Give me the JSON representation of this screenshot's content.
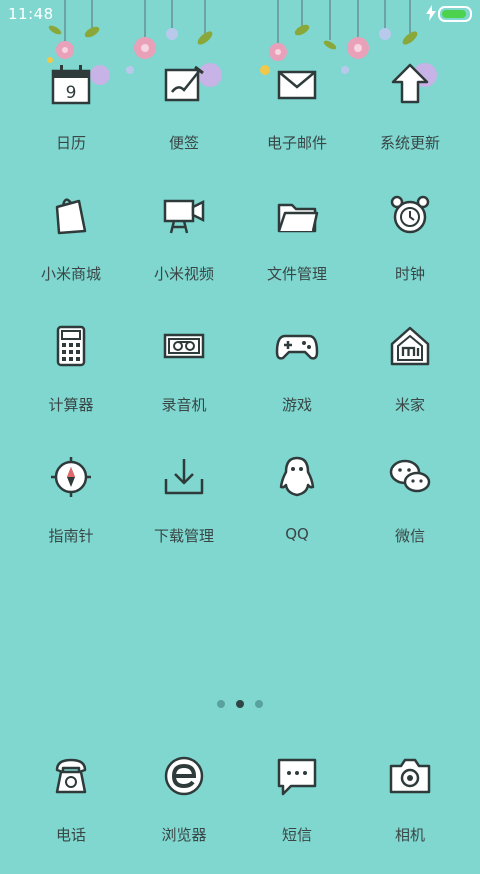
{
  "status_bar": {
    "time": "11:48"
  },
  "apps": [
    {
      "label": "日历",
      "icon": "calendar-icon",
      "calendar_day": "9"
    },
    {
      "label": "便签",
      "icon": "notes-icon"
    },
    {
      "label": "电子邮件",
      "icon": "email-icon"
    },
    {
      "label": "系统更新",
      "icon": "system-update-icon"
    },
    {
      "label": "小米商城",
      "icon": "shopping-bag-icon"
    },
    {
      "label": "小米视频",
      "icon": "video-camera-icon"
    },
    {
      "label": "文件管理",
      "icon": "folder-icon"
    },
    {
      "label": "时钟",
      "icon": "alarm-clock-icon"
    },
    {
      "label": "计算器",
      "icon": "calculator-icon"
    },
    {
      "label": "录音机",
      "icon": "recorder-icon"
    },
    {
      "label": "游戏",
      "icon": "gamepad-icon"
    },
    {
      "label": "米家",
      "icon": "mi-home-icon"
    },
    {
      "label": "指南针",
      "icon": "compass-icon"
    },
    {
      "label": "下载管理",
      "icon": "download-icon"
    },
    {
      "label": "QQ",
      "icon": "qq-penguin-icon"
    },
    {
      "label": "微信",
      "icon": "wechat-icon"
    }
  ],
  "dock": [
    {
      "label": "电话",
      "icon": "phone-icon"
    },
    {
      "label": "浏览器",
      "icon": "browser-icon"
    },
    {
      "label": "短信",
      "icon": "message-icon"
    },
    {
      "label": "相机",
      "icon": "camera-icon"
    }
  ],
  "page_indicator": {
    "pages": 3,
    "current": 2
  },
  "colors": {
    "background": "#7fd7cf",
    "battery": "#4cd24c"
  }
}
